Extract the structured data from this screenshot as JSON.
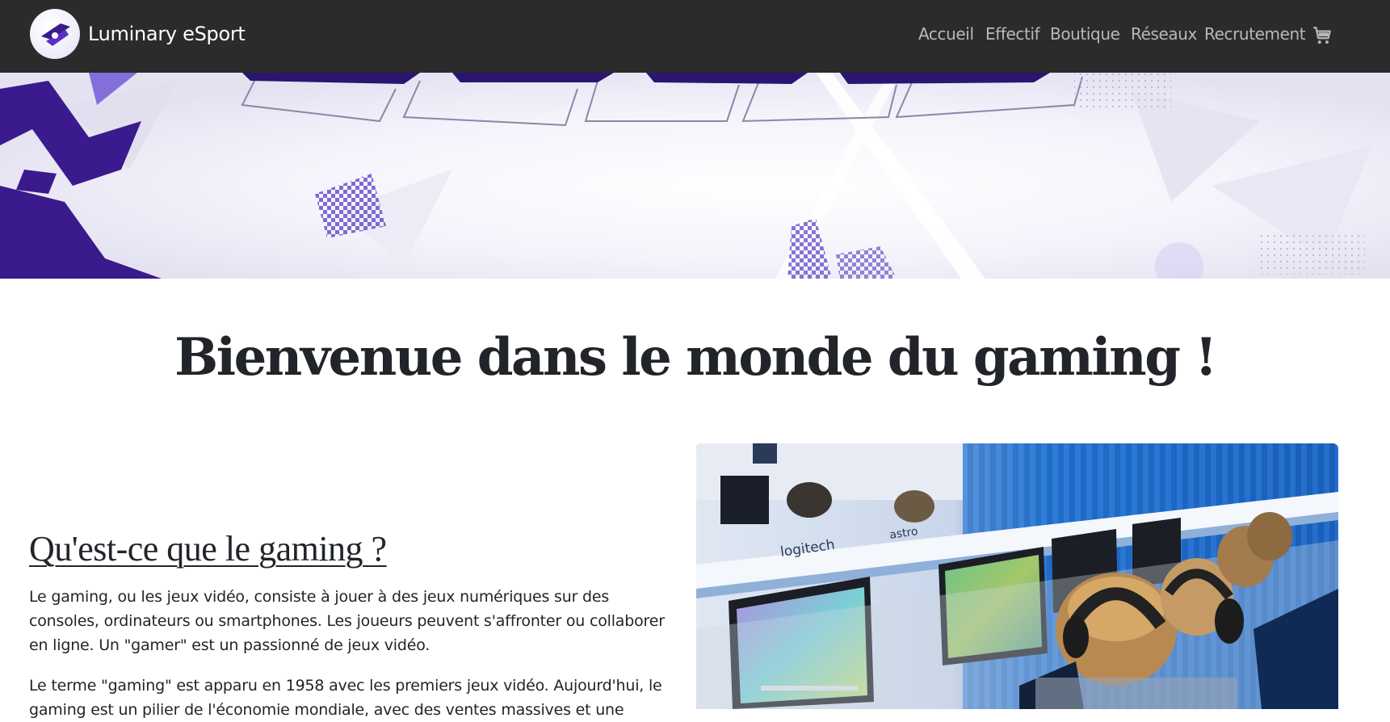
{
  "navbar": {
    "brand_name": "Luminary eSport",
    "logo_icon": "luminary-logo",
    "links": [
      {
        "label": "Accueil"
      },
      {
        "label": "Effectif"
      },
      {
        "label": "Boutique"
      },
      {
        "label": "Réseaux"
      },
      {
        "label": "Recrutement"
      }
    ],
    "cart_icon": "shopping-cart-icon",
    "background": "#2b2b2b",
    "link_color": "#b8b8b8"
  },
  "hero": {
    "image_description": "Luminary banner artwork",
    "accent": "#3a1a8c"
  },
  "main": {
    "heading": "Bienvenue dans le monde du gaming !",
    "section_title": "Qu'est-ce que le gaming ?",
    "paragraphs": [
      "Le gaming, ou les jeux vidéo, consiste à jouer à des jeux numériques sur des consoles, ordinateurs ou smartphones. Les joueurs peuvent s'affronter ou collaborer en ligne. Un \"gamer\" est un passionné de jeux vidéo.",
      "Le terme \"gaming\" est apparu en 1958 avec les premiers jeux vidéo. Aujourd'hui, le gaming est un pilier de l'économie mondiale, avec des ventes massives et une"
    ],
    "photo": {
      "sponsor_text": "logitech",
      "sponsor_text_2": "astro"
    }
  }
}
